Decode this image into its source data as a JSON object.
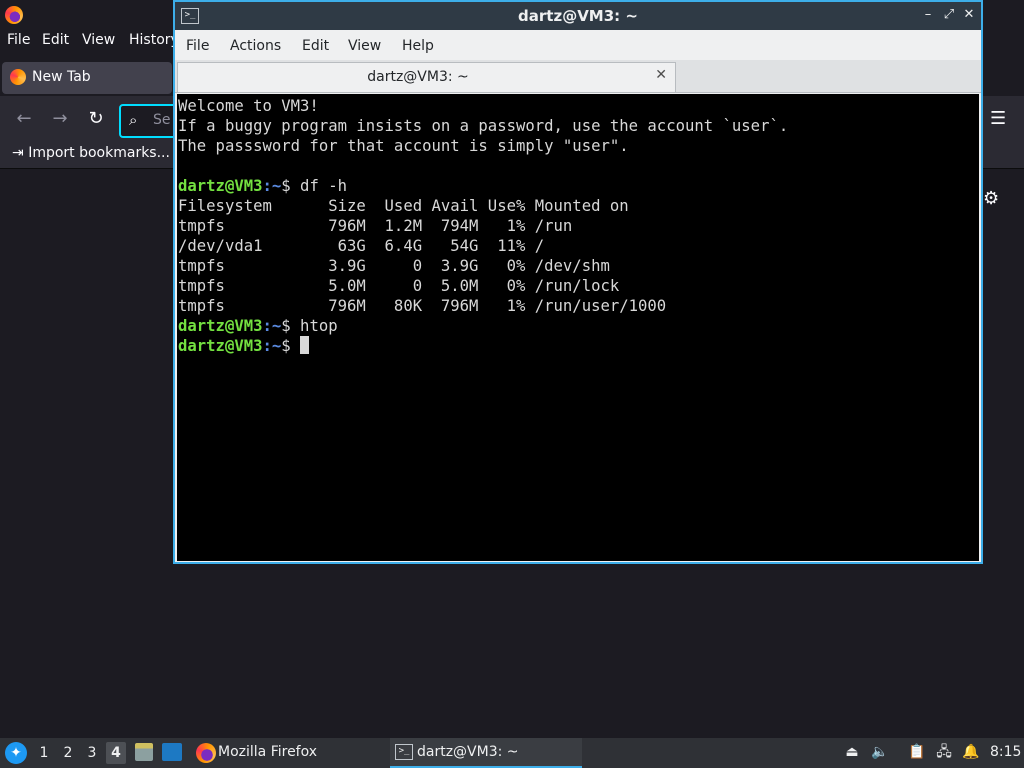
{
  "firefox": {
    "menu": [
      "File",
      "Edit",
      "View",
      "History"
    ],
    "tab_label": "New Tab",
    "url_placeholder": "Se",
    "import_bookmarks": "Import bookmarks..."
  },
  "terminal": {
    "window_title": "dartz@VM3: ~",
    "menu": [
      "File",
      "Actions",
      "Edit",
      "View",
      "Help"
    ],
    "tab_label": "dartz@VM3: ~",
    "prompt_user": "dartz@VM3",
    "prompt_path": ":~",
    "lines": {
      "welcome": "Welcome to VM3!",
      "hint1": "If a buggy program insists on a password, use the account `user`.",
      "hint2": "The passsword for that account is simply \"user\".",
      "cmd1": "$ df -h",
      "df_header": "Filesystem      Size  Used Avail Use% Mounted on",
      "df_rows": [
        "tmpfs           796M  1.2M  794M   1% /run",
        "/dev/vda1        63G  6.4G   54G  11% /",
        "tmpfs           3.9G     0  3.9G   0% /dev/shm",
        "tmpfs           5.0M     0  5.0M   0% /run/lock",
        "tmpfs           796M   80K  796M   1% /run/user/1000"
      ],
      "cmd2": "$ htop",
      "cmd3": "$ "
    }
  },
  "taskbar": {
    "workspaces": [
      "1",
      "2",
      "3",
      "4"
    ],
    "firefox_label": "Mozilla Firefox",
    "terminal_label": "dartz@VM3: ~",
    "clock": "8:15"
  },
  "colors": {
    "accent": "#3daee9",
    "prompt_user": "#73e040",
    "prompt_path": "#5a8ae0"
  }
}
